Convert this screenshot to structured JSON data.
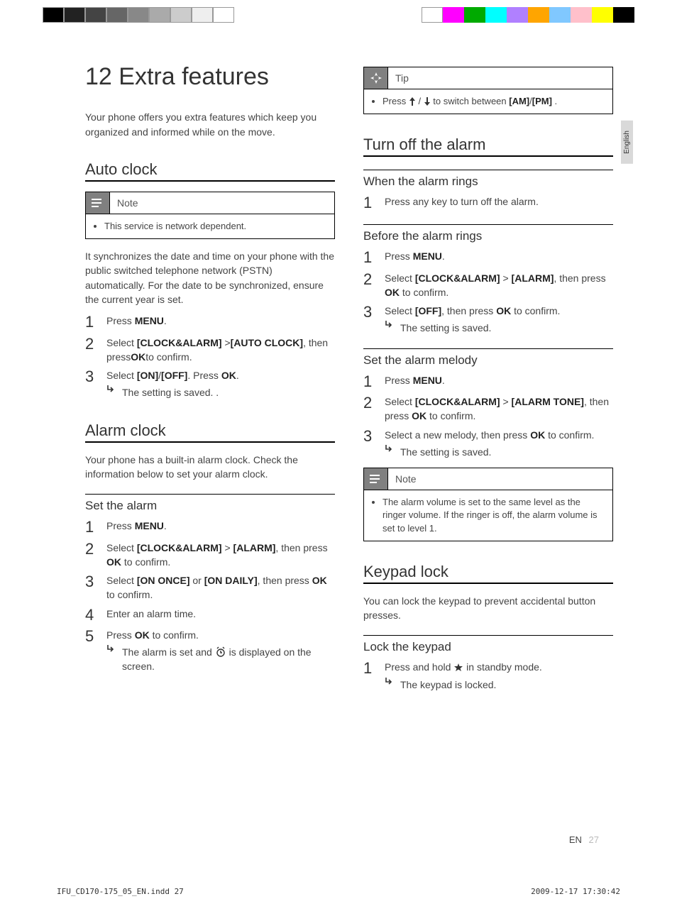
{
  "lang_tab": "English",
  "title": "12 Extra features",
  "intro": "Your phone offers you extra features which keep you organized and informed while on the move.",
  "auto_clock": {
    "heading": "Auto clock",
    "note_label": "Note",
    "note_body": "This service is network dependent.",
    "desc": "It synchronizes the date and time on your phone with the public switched telephone network (PSTN) automatically. For the date to be synchronized, ensure the current year is set.",
    "s1_a": "Press ",
    "s1_b": "MENU",
    "s1_c": ".",
    "s2_a": "Select ",
    "s2_b": "[CLOCK&ALARM]",
    "s2_c": " >",
    "s2_d": "[AUTO CLOCK]",
    "s2_e": ", then press",
    "s2_f": "OK",
    "s2_g": "to confirm.",
    "s3_a": "Select ",
    "s3_b": "[ON]",
    "s3_c": "/",
    "s3_d": "[OFF]",
    "s3_e": ". Press ",
    "s3_f": "OK",
    "s3_g": ".",
    "s3_r": "The setting is saved. ."
  },
  "alarm_clock": {
    "heading": "Alarm clock",
    "desc": "Your phone has a built-in alarm clock. Check the information below to set your alarm clock.",
    "set_heading": "Set the alarm",
    "s1_a": "Press ",
    "s1_b": "MENU",
    "s1_c": ".",
    "s2_a": "Select ",
    "s2_b": "[CLOCK&ALARM]",
    "s2_c": " > ",
    "s2_d": "[ALARM]",
    "s2_e": ", then press ",
    "s2_f": "OK",
    "s2_g": " to confirm.",
    "s3_a": "Select ",
    "s3_b": "[ON ONCE]",
    "s3_c": " or ",
    "s3_d": "[ON DAILY]",
    "s3_e": ", then press ",
    "s3_f": "OK",
    "s3_g": " to confirm.",
    "s4": "Enter an alarm time.",
    "s5_a": "Press ",
    "s5_b": "OK",
    "s5_c": " to confirm.",
    "s5_r_a": "The alarm is set and ",
    "s5_r_b": " is displayed on the screen."
  },
  "tip": {
    "label": "Tip",
    "a": "Press ",
    "b": " to switch between ",
    "c": "[AM]",
    "d": "/",
    "e": "[PM]",
    "f": " ."
  },
  "turn_off": {
    "heading": "Turn off the alarm",
    "rings_h": "When the alarm rings",
    "s1": "Press any key to turn off the alarm.",
    "before_h": "Before the alarm rings",
    "b1_a": "Press ",
    "b1_b": "MENU",
    "b1_c": ".",
    "b2_a": "Select ",
    "b2_b": "[CLOCK&ALARM]",
    "b2_c": " > ",
    "b2_d": "[ALARM]",
    "b2_e": ", then press ",
    "b2_f": "OK",
    "b2_g": " to confirm.",
    "b3_a": "Select ",
    "b3_b": "[OFF]",
    "b3_c": ", then press ",
    "b3_d": "OK",
    "b3_e": " to confirm.",
    "b3_r": "The setting is saved."
  },
  "melody": {
    "heading": "Set the alarm melody",
    "s1_a": "Press ",
    "s1_b": "MENU",
    "s1_c": ".",
    "s2_a": "Select ",
    "s2_b": "[CLOCK&ALARM]",
    "s2_c": " > ",
    "s2_d": "[ALARM TONE]",
    "s2_e": ", then press ",
    "s2_f": "OK",
    "s2_g": " to confirm.",
    "s3_a": "Select a new melody, then press ",
    "s3_b": "OK",
    "s3_c": " to confirm.",
    "s3_r": "The setting is saved.",
    "note_label": "Note",
    "note_body": "The alarm volume is set to the same level as the ringer volume. If the ringer is off, the alarm volume is set to level 1."
  },
  "keypad": {
    "heading": "Keypad lock",
    "desc": "You can lock the keypad to prevent accidental button presses.",
    "lock_h": "Lock the keypad",
    "s1_a": "Press and hold ",
    "s1_b": " in standby mode.",
    "s1_r": "The keypad is locked."
  },
  "footer_lang": "EN",
  "footer_page": "27",
  "slug_left": "IFU_CD170-175_05_EN.indd   27",
  "slug_right": "2009-12-17   17:30:42"
}
